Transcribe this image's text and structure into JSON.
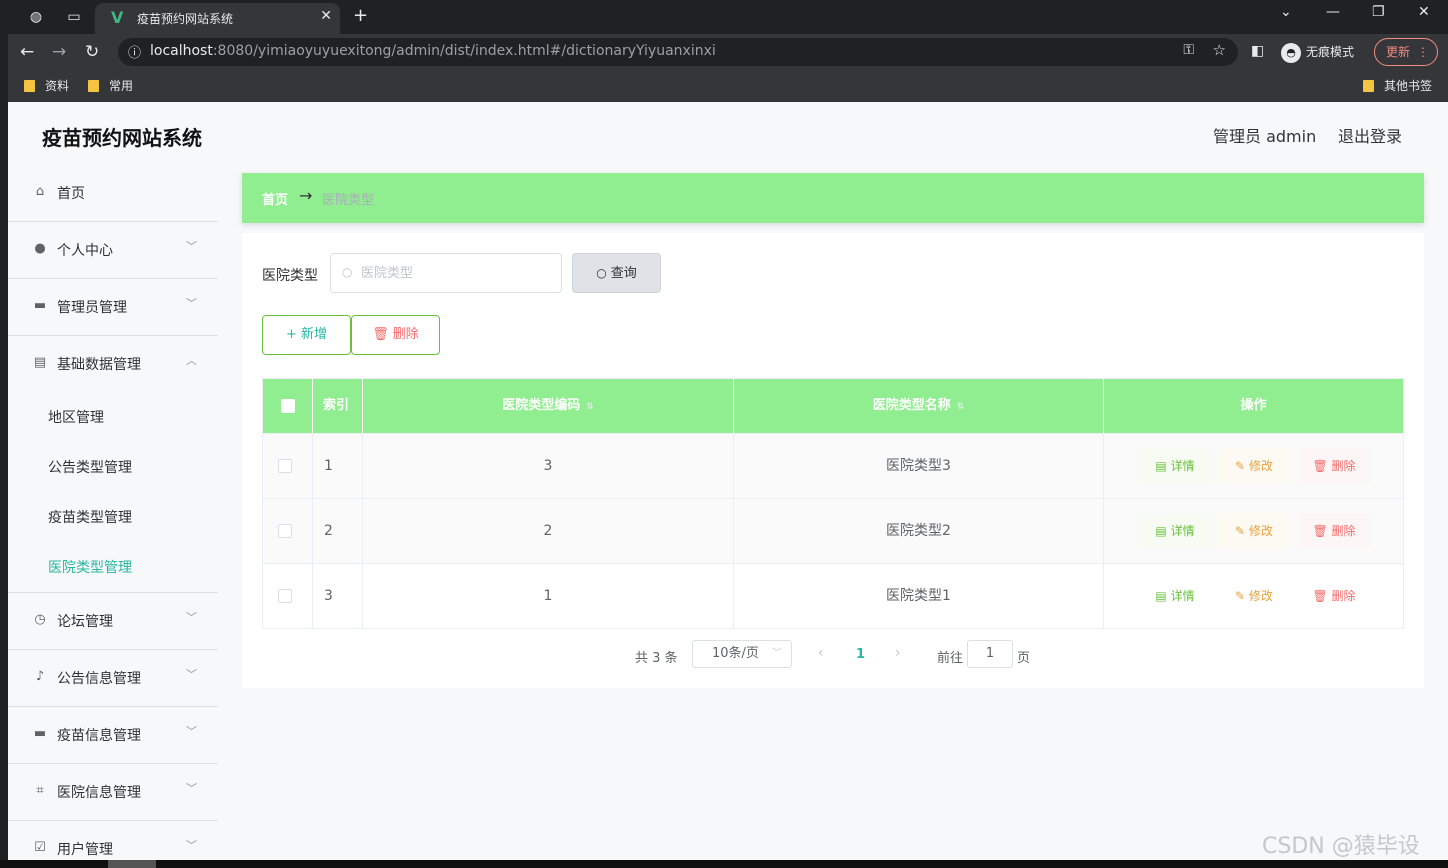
{
  "browser": {
    "tab_title": "疫苗预约网站系统",
    "url_host": "localhost",
    "url_rest": ":8080/yimiaoyuyuexitong/admin/dist/index.html#/dictionaryYiyuanxinxi",
    "incognito_label": "无痕模式",
    "update_label": "更新",
    "bookmarks": [
      "资料",
      "常用"
    ],
    "other_bookmarks": "其他书签"
  },
  "header": {
    "title": "疫苗预约网站系统",
    "admin_label": "管理员 admin",
    "logout_label": "退出登录"
  },
  "sidebar": {
    "items": [
      {
        "label": "首页",
        "icon": "home-icon"
      },
      {
        "label": "个人中心",
        "icon": "user-icon"
      },
      {
        "label": "管理员管理",
        "icon": "briefcase-icon"
      },
      {
        "label": "基础数据管理",
        "icon": "clipboard-icon"
      },
      {
        "label": "论坛管理",
        "icon": "clock-icon"
      },
      {
        "label": "公告信息管理",
        "icon": "microphone-icon"
      },
      {
        "label": "疫苗信息管理",
        "icon": "monitor-icon"
      },
      {
        "label": "医院信息管理",
        "icon": "crop-icon"
      },
      {
        "label": "用户管理",
        "icon": "checklist-icon"
      }
    ],
    "subitems": [
      "地区管理",
      "公告类型管理",
      "疫苗类型管理",
      "医院类型管理"
    ],
    "active_subitem": "医院类型管理"
  },
  "breadcrumb": {
    "home": "首页",
    "separator": "→",
    "current": "医院类型"
  },
  "search": {
    "label": "医院类型",
    "placeholder": "医院类型",
    "button": "查询"
  },
  "actions": {
    "add": "新增",
    "delete": "删除"
  },
  "table": {
    "headers": [
      "索引",
      "医院类型编码",
      "医院类型名称",
      "操作"
    ],
    "rows": [
      {
        "index": "1",
        "code": "3",
        "name": "医院类型3"
      },
      {
        "index": "2",
        "code": "2",
        "name": "医院类型2"
      },
      {
        "index": "3",
        "code": "1",
        "name": "医院类型1"
      }
    ],
    "row_actions": {
      "detail": "详情",
      "edit": "修改",
      "delete": "删除"
    }
  },
  "pagination": {
    "total": "共 3 条",
    "page_size": "10条/页",
    "current_page": "1",
    "goto_label": "前往",
    "goto_value": "1",
    "page_unit": "页"
  },
  "watermark": "CSDN @猿毕设",
  "colors": {
    "accent_green": "#90ee90",
    "active_teal": "#29b6a1",
    "danger_red": "#f56c6c",
    "warning_orange": "#e6a23c",
    "success_green": "#67c23a"
  }
}
